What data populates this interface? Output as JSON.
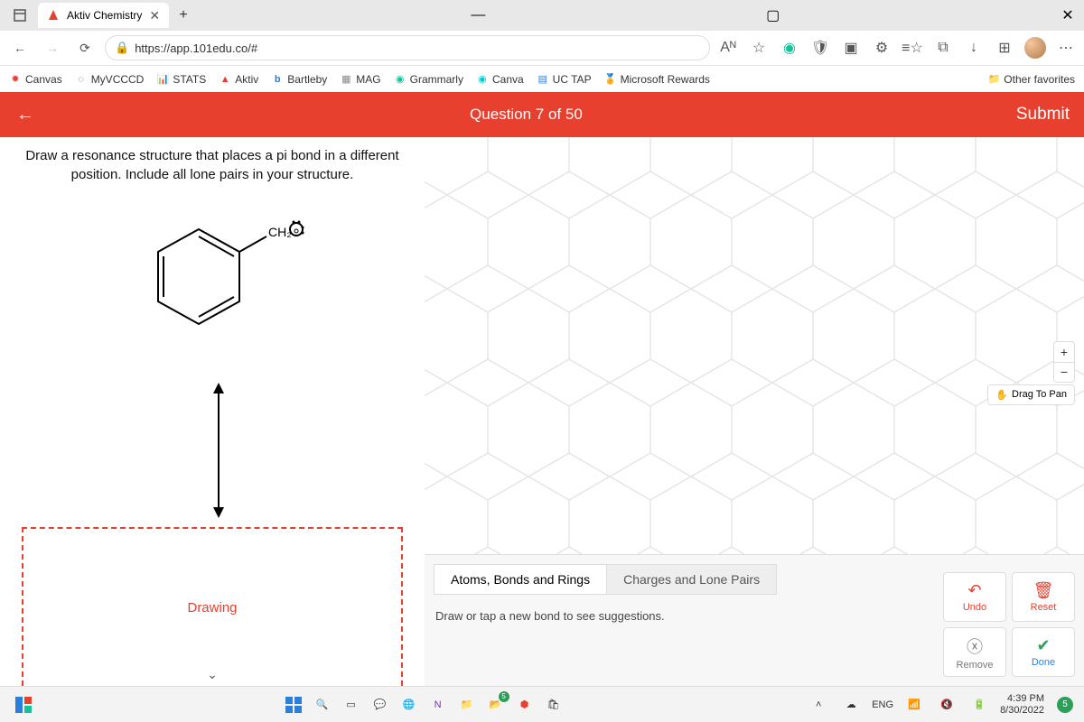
{
  "browser": {
    "tab_title": "Aktiv Chemistry",
    "url": "https://app.101edu.co/#",
    "window_controls": {
      "min": "—",
      "max": "▢",
      "close": "✕"
    }
  },
  "bookmarks": {
    "items": [
      {
        "label": "Canvas"
      },
      {
        "label": "MyVCCCD"
      },
      {
        "label": "STATS"
      },
      {
        "label": "Aktiv"
      },
      {
        "label": "Bartleby"
      },
      {
        "label": "MAG"
      },
      {
        "label": "Grammarly"
      },
      {
        "label": "Canva"
      },
      {
        "label": "UC TAP"
      },
      {
        "label": "Microsoft Rewards"
      }
    ],
    "other": "Other favorites"
  },
  "app": {
    "question_title": "Question 7 of 50",
    "submit": "Submit",
    "prompt_line1": "Draw a resonance structure that places a pi bond in a different",
    "prompt_line2": "position. Include all lone pairs in your structure.",
    "ch2_label": "CH₂",
    "drawing_label": "Drawing",
    "drag_pan": "Drag To Pan",
    "panel": {
      "tab_atoms": "Atoms, Bonds and Rings",
      "tab_charges": "Charges and Lone Pairs",
      "hint": "Draw or tap a new bond to see suggestions.",
      "undo": "Undo",
      "reset": "Reset",
      "remove": "Remove",
      "done": "Done"
    }
  },
  "taskbar": {
    "lang": "ENG",
    "time": "4:39 PM",
    "date": "8/30/2022",
    "notif_count": "5",
    "explorer_badge": "5"
  }
}
